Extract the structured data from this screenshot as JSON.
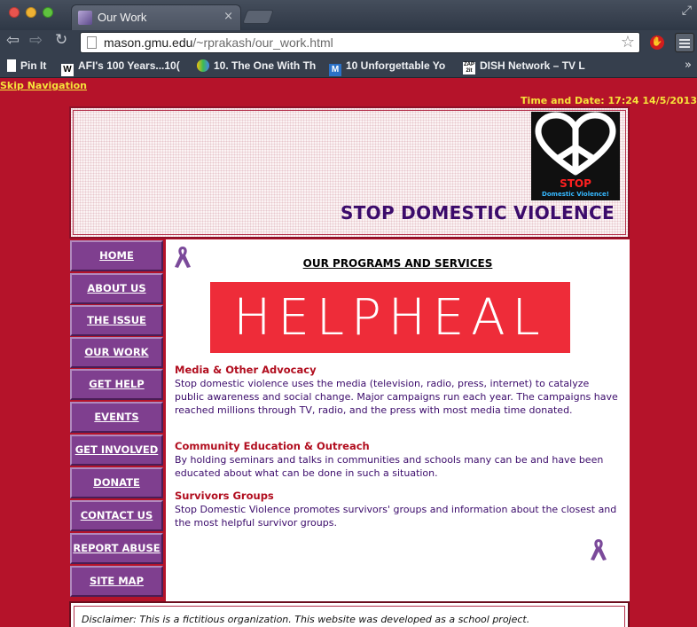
{
  "browser": {
    "tab_title": "Our Work",
    "tab_close": "×",
    "url_host": "mason.gmu.edu",
    "url_path": "/~rprakash/our_work.html",
    "bookmarks": [
      {
        "icon": "pin",
        "label": "Pin It"
      },
      {
        "icon": "W",
        "label": "AFI's 100 Years...10("
      },
      {
        "icon": "pinwheel",
        "label": "10. The One With Th"
      },
      {
        "icon": "M",
        "label": "10 Unforgettable Yo"
      },
      {
        "icon": "ZAP",
        "label": "DISH Network – TV L"
      }
    ],
    "more": "»"
  },
  "page": {
    "skip_nav": "Skip Navigation",
    "datetime": "Time and Date: 17:24 14/5/2013",
    "site_title": "STOP DOMESTIC VIOLENCE",
    "logo_word": "STOP",
    "logo_sub": "Domestic Violence!",
    "nav": [
      {
        "label": "HOME",
        "active": false
      },
      {
        "label": "ABOUT US",
        "active": false
      },
      {
        "label": "THE ISSUE",
        "active": false
      },
      {
        "label": "OUR WORK",
        "active": true
      },
      {
        "label": "GET HELP",
        "active": false
      },
      {
        "label": "EVENTS",
        "active": false
      },
      {
        "label": "GET INVOLVED",
        "active": false
      },
      {
        "label": "DONATE",
        "active": false
      },
      {
        "label": "CONTACT US",
        "active": false
      },
      {
        "label": "REPORT ABUSE",
        "active": false
      },
      {
        "label": "SITE MAP",
        "active": false
      }
    ],
    "programs_title": "OUR PROGRAMS AND SERVICES",
    "banner_text": "HELPHEAL",
    "sections": [
      {
        "heading": "Media & Other Advocacy",
        "body": "Stop domestic violence uses the media (television, radio, press, internet) to catalyze public awareness and social change. Major campaigns run each year. The campaigns have reached millions through TV, radio, and the press with most media time donated."
      },
      {
        "heading": "Community Education & Outreach",
        "body": "By holding seminars and talks in communities and schools many can be and have been educated about what can be done in such a situation."
      },
      {
        "heading": "Survivors Groups",
        "body": "Stop Domestic Violence promotes survivors' groups and information about the closest and the most helpful survivor groups."
      }
    ],
    "disclaimer": "Disclaimer: This is a fictitious organization. This website was developed as a school project."
  },
  "colors": {
    "page_bg": "#b5132a",
    "nav_bg": "#7f3f8f",
    "title_purple": "#3b0b6b",
    "heading_red": "#b10d1e",
    "link_yellow": "#f5e23a",
    "banner_red": "#ee2c39"
  }
}
